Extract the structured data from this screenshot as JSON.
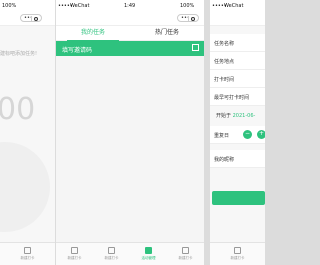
{
  "left": {
    "status_battery": "100%",
    "hint": "建标吧添加任务!",
    "big_number": "00",
    "tabs": [
      {
        "label": "新建打卡",
        "icon": "plus-square-icon"
      }
    ]
  },
  "middle": {
    "status_signal": "•••••",
    "status_carrier": "WeChat",
    "status_time": "1:49",
    "status_battery": "100%",
    "tabs": [
      {
        "label": "我的任务",
        "active": true
      },
      {
        "label": "热门任务",
        "active": false
      }
    ],
    "invite_label": "填写邀请码",
    "bottom_tabs": [
      {
        "label": "新建打卡",
        "icon": "plus-square-icon",
        "active": false
      },
      {
        "label": "新建打卡",
        "icon": "check-square-icon",
        "active": false
      },
      {
        "label": "活动管理",
        "icon": "document-icon",
        "active": true
      },
      {
        "label": "新建打卡",
        "icon": "plus-square-icon",
        "active": false
      }
    ]
  },
  "right": {
    "status_signal": "•••••",
    "status_carrier": "WeChat",
    "fields": [
      "任务名称",
      "任务地点",
      "打卡时间",
      "最早可打卡时间"
    ],
    "start_prefix": "开始于",
    "start_date": "2021-06-",
    "repeat_label": "重复日",
    "nickname_label": "我的昵称",
    "tab": {
      "label": "新建打卡",
      "icon": "plus-square-icon"
    }
  },
  "colors": {
    "accent": "#2ec27e"
  }
}
